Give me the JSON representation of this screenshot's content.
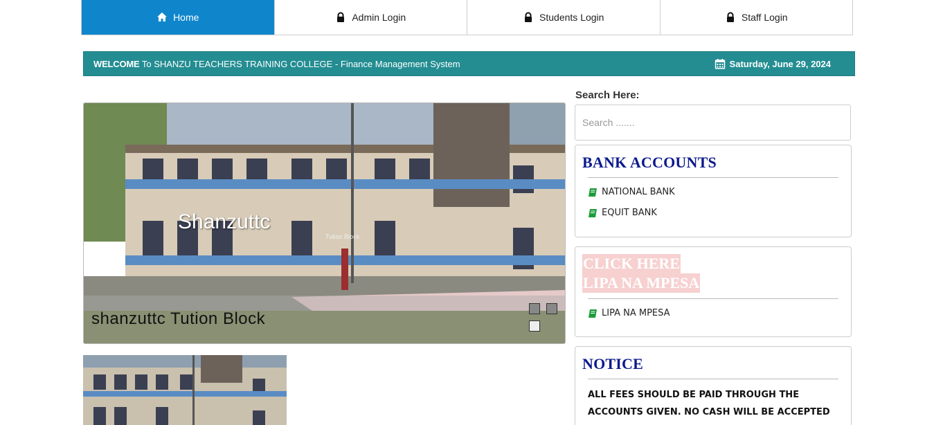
{
  "nav": {
    "items": [
      {
        "label": "Home",
        "icon": "home-icon",
        "active": true
      },
      {
        "label": "Admin Login",
        "icon": "lock-icon",
        "active": false
      },
      {
        "label": "Students Login",
        "icon": "lock-icon",
        "active": false
      },
      {
        "label": "Staff Login",
        "icon": "lock-icon",
        "active": false
      }
    ]
  },
  "welcome": {
    "strong": "WELCOME",
    "text": " To SHANZU TEACHERS TRAINING COLLEGE - Finance Management System",
    "date": "Saturday, June 29, 2024"
  },
  "slider": {
    "title": "Shanzuttc",
    "small_text": "Tution Block",
    "caption": "shanzuttc Tution Block"
  },
  "search": {
    "label": "Search Here:",
    "placeholder": "Search ......."
  },
  "bank_accounts": {
    "heading": "BANK ACCOUNTS",
    "items": [
      "NATIONAL BANK",
      "EQUIT BANK"
    ]
  },
  "mpesa": {
    "line1": "CLICK HERE",
    "line2": "LIPA NA MPESA",
    "items": [
      "LIPA NA MPESA"
    ]
  },
  "notice": {
    "heading": "NOTICE",
    "text": "ALL FEES SHOULD BE PAID THROUGH THE ACCOUNTS GIVEN. NO CASH WILL BE ACCEPTED"
  },
  "colors": {
    "nav_active": "#0f86cc",
    "welcome_bar": "#238d92",
    "panel_heading": "#0b1a8c",
    "book_icon": "#1e9c3a"
  }
}
